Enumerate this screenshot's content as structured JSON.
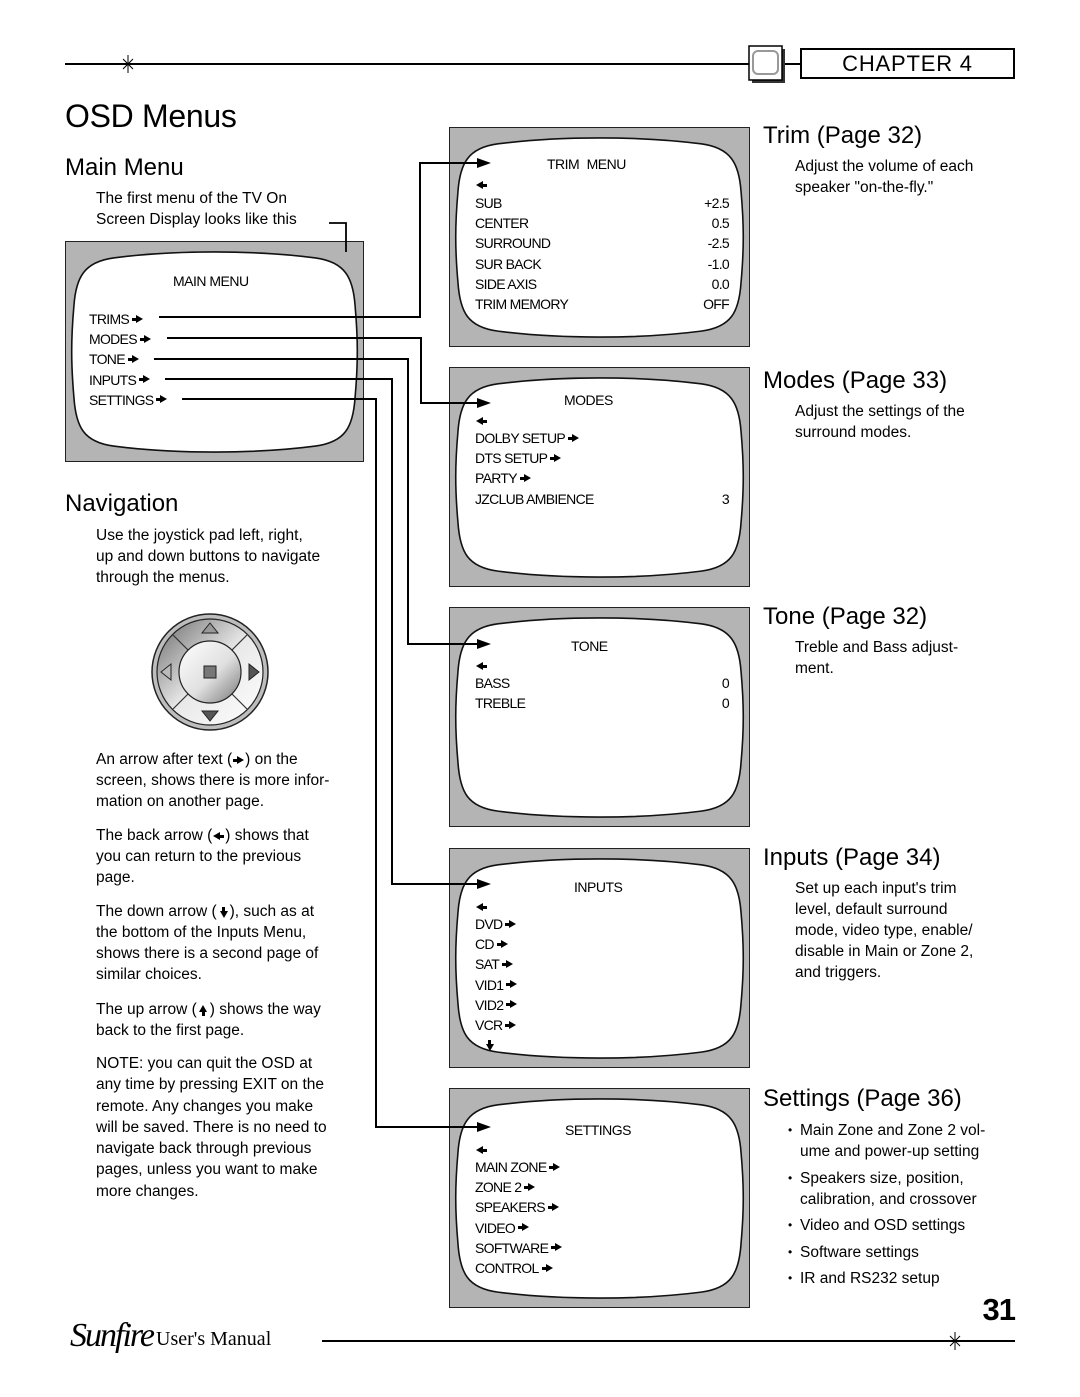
{
  "header": {
    "chapter_label": "CHAPTER 4",
    "page_title": "OSD Menus"
  },
  "main_menu_section": {
    "heading": "Main Menu",
    "intro_lines": [
      "The first menu of the TV On",
      "Screen Display looks like this"
    ],
    "osd": {
      "title": "MAIN MENU",
      "items": [
        "TRIMS",
        "MODES",
        "TONE",
        "INPUTS",
        "SETTINGS"
      ]
    }
  },
  "navigation_section": {
    "heading": "Navigation",
    "intro_lines": [
      "Use the joystick pad left, right,",
      "up and down buttons to navigate",
      "through the menus."
    ],
    "joystick_icon": "joystick-pad-icon",
    "paragraphs": [
      {
        "pre": "An arrow after text (",
        "icon": "right-arrow",
        "post": ") on the",
        "rest": [
          "screen, shows there is more infor-",
          "mation on another page."
        ]
      },
      {
        "pre": "The back arrow (",
        "icon": "left-arrow",
        "post": ") shows that",
        "rest": [
          "you can return to the previous",
          "page."
        ]
      },
      {
        "pre": "The down arrow (",
        "icon": "down-arrow",
        "post": "), such as at",
        "rest": [
          "the bottom of the Inputs Menu,",
          "shows there is a second page of",
          "similar choices."
        ]
      },
      {
        "pre": "The up arrow (",
        "icon": "up-arrow",
        "post": ") shows the way",
        "rest": [
          "back to the first page."
        ]
      }
    ],
    "note_lines": [
      "NOTE: you can quit the OSD at",
      "any time by pressing EXIT on the",
      "remote. Any changes you make",
      "will be saved. There is no need to",
      "navigate back through previous",
      "pages, unless you want to make",
      "more changes."
    ]
  },
  "submenus": [
    {
      "osd_title": "TRIM MENU",
      "rows": [
        {
          "label": "SUB",
          "value": "+2.5"
        },
        {
          "label": "CENTER",
          "value": "0.5"
        },
        {
          "label": "SURROUND",
          "value": "-2.5"
        },
        {
          "label": "SUR BACK",
          "value": "-1.0"
        },
        {
          "label": "SIDE AXIS",
          "value": "0.0"
        },
        {
          "label": "TRIM MEMORY",
          "value": "OFF"
        }
      ],
      "heading": "Trim (Page 32)",
      "description_lines": [
        "Adjust the volume of each",
        "speaker \"on-the-fly.\""
      ]
    },
    {
      "osd_title": "MODES",
      "rows": [
        {
          "label": "DOLBY SETUP",
          "has_arrow": true
        },
        {
          "label": "DTS SETUP",
          "has_arrow": true
        },
        {
          "label": "PARTY",
          "has_arrow": true
        },
        {
          "label": "JZCLUB AMBIENCE",
          "value": "3"
        }
      ],
      "heading": "Modes (Page 33)",
      "description_lines": [
        "Adjust the settings of the",
        "surround modes."
      ]
    },
    {
      "osd_title": "TONE",
      "rows": [
        {
          "label": "BASS",
          "value": "0"
        },
        {
          "label": "TREBLE",
          "value": "0"
        }
      ],
      "heading": "Tone (Page 32)",
      "description_lines": [
        "Treble and Bass adjust-",
        "ment."
      ]
    },
    {
      "osd_title": "INPUTS",
      "rows": [
        {
          "label": "DVD",
          "has_arrow": true
        },
        {
          "label": "CD",
          "has_arrow": true
        },
        {
          "label": "SAT",
          "has_arrow": true
        },
        {
          "label": "VID1",
          "has_arrow": true
        },
        {
          "label": "VID2",
          "has_arrow": true
        },
        {
          "label": "VCR",
          "has_arrow": true
        }
      ],
      "has_more_below": true,
      "heading": "Inputs (Page 34)",
      "description_lines": [
        "Set up each input's trim",
        "level, default surround",
        "mode, video type, enable/",
        "disable in Main or Zone 2,",
        "and triggers."
      ]
    },
    {
      "osd_title": "SETTINGS",
      "rows": [
        {
          "label": "MAIN ZONE",
          "has_arrow": true
        },
        {
          "label": "ZONE 2",
          "has_arrow": true
        },
        {
          "label": "SPEAKERS",
          "has_arrow": true
        },
        {
          "label": "VIDEO",
          "has_arrow": true
        },
        {
          "label": "SOFTWARE",
          "has_arrow": true
        },
        {
          "label": "CONTROL",
          "has_arrow": true
        }
      ],
      "heading": "Settings (Page 36)",
      "bullets": [
        [
          "Main Zone and Zone 2 vol-",
          "ume and power-up setting"
        ],
        [
          "Speakers size, position,",
          "calibration, and crossover"
        ],
        [
          "Video and OSD settings"
        ],
        [
          "Software settings"
        ],
        [
          "IR and RS232 setup"
        ]
      ]
    }
  ],
  "footer": {
    "brand": "Sunfire",
    "manual_label": "User's Manual",
    "page_number": "31"
  },
  "colors": {
    "tv_bezel": "#b4b4b4",
    "text": "#000000",
    "background": "#ffffff"
  }
}
